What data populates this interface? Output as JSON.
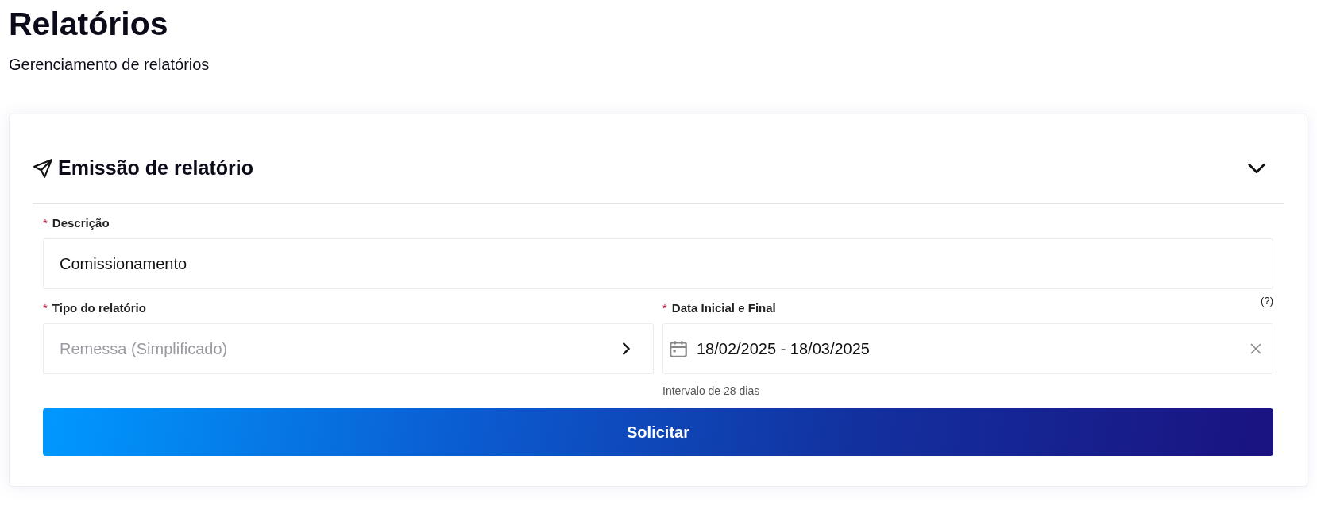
{
  "page": {
    "title": "Relatórios",
    "subtitle": "Gerenciamento de relatórios"
  },
  "card": {
    "title": "Emissão de relatório",
    "expanded": true,
    "description": {
      "required_mark": "*",
      "label": "Descrição",
      "value": "Comissionamento"
    },
    "report_type": {
      "required_mark": "*",
      "label": "Tipo do relatório",
      "placeholder": "Remessa (Simplificado)"
    },
    "date_range": {
      "required_mark": "*",
      "label": "Data Inicial e Final",
      "help": "(?)",
      "value": "18/02/2025 - 18/03/2025",
      "hint": "Intervalo de 28 dias"
    },
    "submit": "Solicitar"
  }
}
